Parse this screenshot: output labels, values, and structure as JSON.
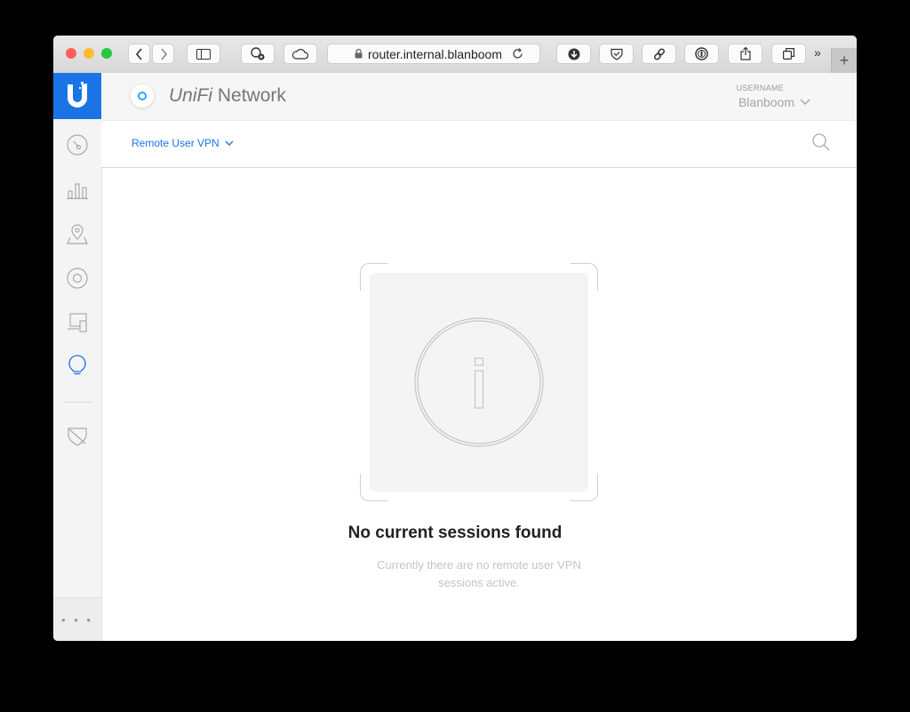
{
  "browser": {
    "url": "router.internal.blanboom.c",
    "more_label": "»",
    "new_tab_label": "+"
  },
  "app": {
    "brand_prefix": "UniFi",
    "brand_suffix": " Network",
    "username_label": "USERNAME",
    "username": "Blanboom"
  },
  "subbar": {
    "dropdown_label": "Remote User VPN"
  },
  "empty": {
    "title": "No current sessions found",
    "message": "Currently there are no remote user VPN sessions active."
  },
  "sidebar": {
    "more_label": "• • •"
  },
  "colors": {
    "accent": "#1a74e6"
  }
}
